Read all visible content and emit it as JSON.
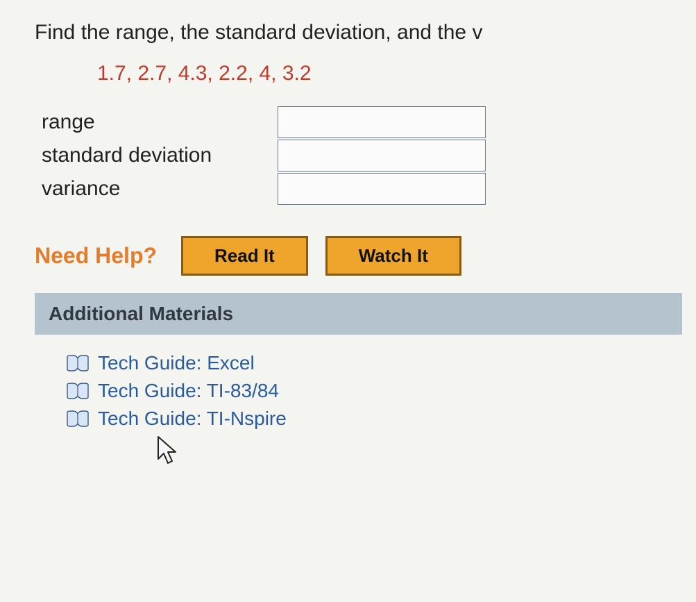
{
  "question": {
    "prompt": "Find the range, the standard deviation, and the v",
    "data_values": "1.7, 2.7, 4.3, 2.2, 4, 3.2",
    "fields": {
      "range": {
        "label": "range",
        "value": ""
      },
      "stddev": {
        "label": "standard deviation",
        "value": ""
      },
      "variance": {
        "label": "variance",
        "value": ""
      }
    }
  },
  "help": {
    "heading": "Need Help?",
    "read_label": "Read It",
    "watch_label": "Watch It"
  },
  "materials": {
    "heading": "Additional Materials",
    "items": [
      {
        "label": "Tech Guide: Excel"
      },
      {
        "label": "Tech Guide: TI-83/84"
      },
      {
        "label": "Tech Guide: TI-Nspire"
      }
    ]
  }
}
